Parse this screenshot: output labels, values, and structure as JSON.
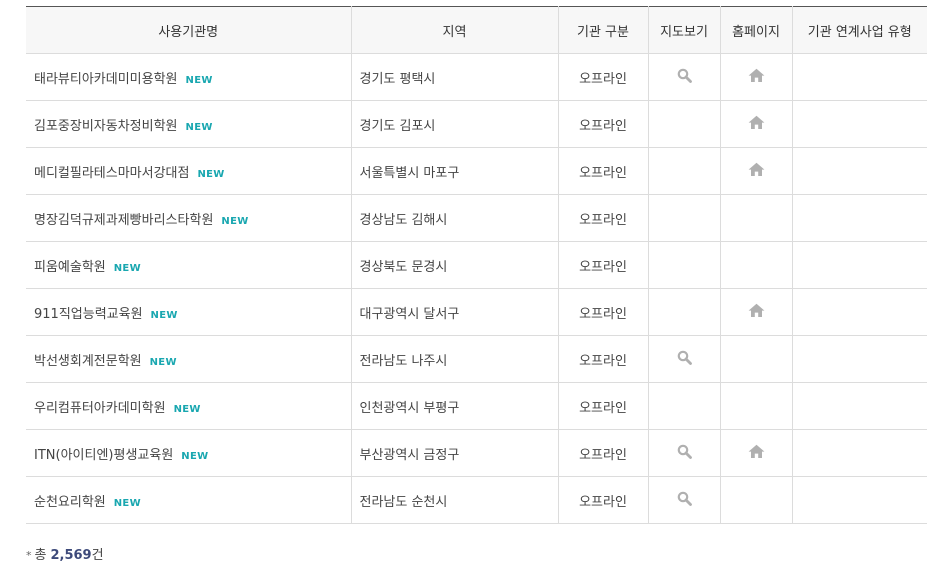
{
  "table": {
    "headers": {
      "name": "사용기관명",
      "region": "지역",
      "type": "기관 구분",
      "map": "지도보기",
      "home": "홈페이지",
      "linked": "기관 연계사업 유형"
    },
    "rows": [
      {
        "name": "태라뷰티아카데미미용학원",
        "badge": "NEW",
        "region": "경기도 평택시",
        "type": "오프라인",
        "map": true,
        "home": true
      },
      {
        "name": "김포중장비자동차정비학원",
        "badge": "NEW",
        "region": "경기도 김포시",
        "type": "오프라인",
        "map": false,
        "home": true
      },
      {
        "name": "메디컬필라테스마마서강대점",
        "badge": "NEW",
        "region": "서울특별시 마포구",
        "type": "오프라인",
        "map": false,
        "home": true
      },
      {
        "name": "명장김덕규제과제빵바리스타학원",
        "badge": "NEW",
        "region": "경상남도 김해시",
        "type": "오프라인",
        "map": false,
        "home": false
      },
      {
        "name": "피움예술학원",
        "badge": "NEW",
        "region": "경상북도 문경시",
        "type": "오프라인",
        "map": false,
        "home": false
      },
      {
        "name": "911직업능력교육원",
        "badge": "NEW",
        "region": "대구광역시 달서구",
        "type": "오프라인",
        "map": false,
        "home": true
      },
      {
        "name": "박선생회계전문학원",
        "badge": "NEW",
        "region": "전라남도 나주시",
        "type": "오프라인",
        "map": true,
        "home": false
      },
      {
        "name": "우리컴퓨터아카데미학원",
        "badge": "NEW",
        "region": "인천광역시 부평구",
        "type": "오프라인",
        "map": false,
        "home": false
      },
      {
        "name": "ITN(아이티엔)평생교육원",
        "badge": "NEW",
        "region": "부산광역시 금정구",
        "type": "오프라인",
        "map": true,
        "home": true
      },
      {
        "name": "순천요리학원",
        "badge": "NEW",
        "region": "전라남도 순천시",
        "type": "오프라인",
        "map": true,
        "home": false
      }
    ]
  },
  "total": {
    "marker": "*",
    "prefix": "총",
    "count": "2,569",
    "suffix": "건"
  },
  "colors": {
    "badge": "#19a7b0",
    "icon": "#b0b0b0",
    "count": "#3d4a7a"
  },
  "icons": {
    "map": "magnifier-icon",
    "home": "home-icon"
  }
}
